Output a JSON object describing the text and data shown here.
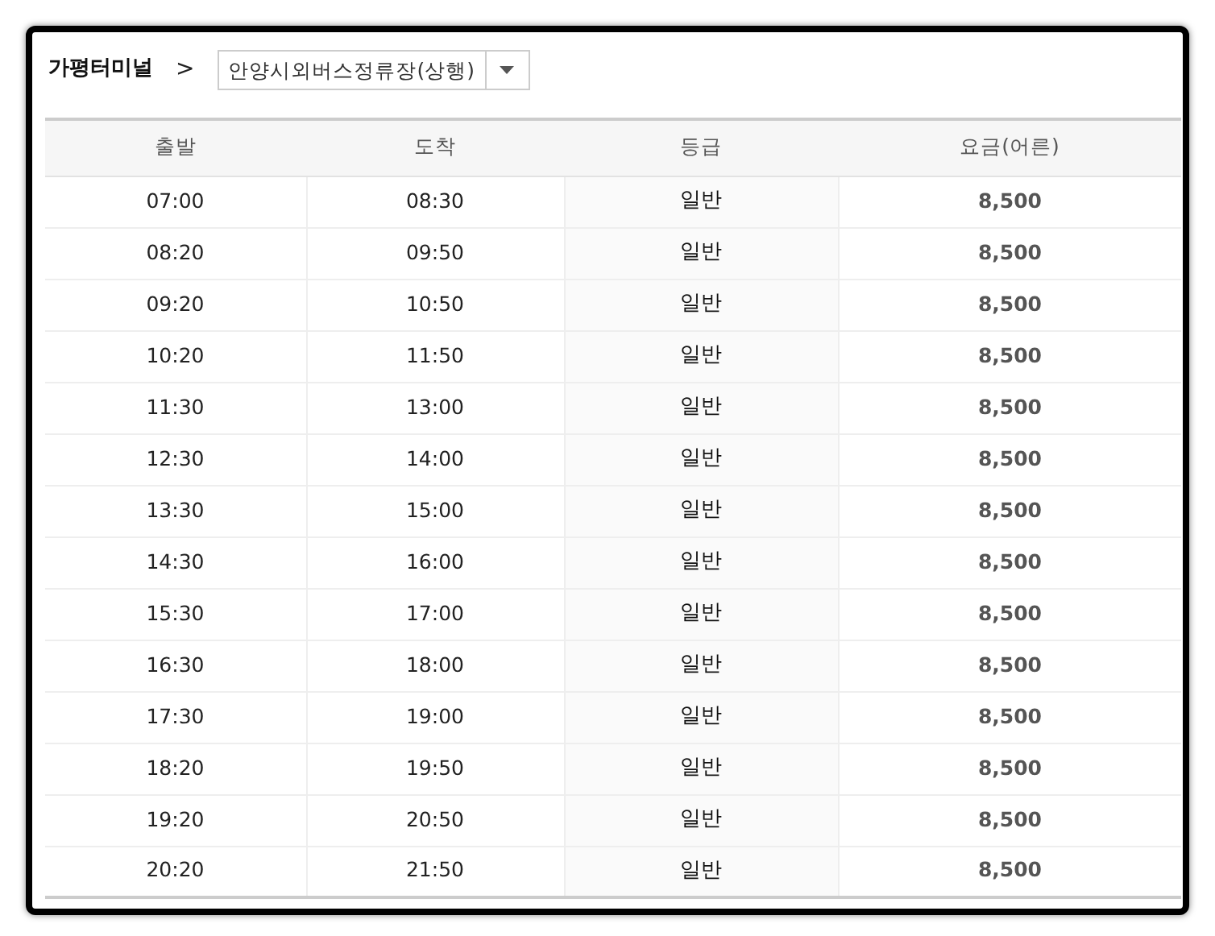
{
  "breadcrumb": {
    "terminal": "가평터미널",
    "separator": ">",
    "route_select": {
      "value": "안양시외버스정류장(상행)"
    }
  },
  "table": {
    "columns": [
      "출발",
      "도착",
      "등급",
      "요금(어른)"
    ],
    "rows": [
      [
        "07:00",
        "08:30",
        "일반",
        "8,500"
      ],
      [
        "08:20",
        "09:50",
        "일반",
        "8,500"
      ],
      [
        "09:20",
        "10:50",
        "일반",
        "8,500"
      ],
      [
        "10:20",
        "11:50",
        "일반",
        "8,500"
      ],
      [
        "11:30",
        "13:00",
        "일반",
        "8,500"
      ],
      [
        "12:30",
        "14:00",
        "일반",
        "8,500"
      ],
      [
        "13:30",
        "15:00",
        "일반",
        "8,500"
      ],
      [
        "14:30",
        "16:00",
        "일반",
        "8,500"
      ],
      [
        "15:30",
        "17:00",
        "일반",
        "8,500"
      ],
      [
        "16:30",
        "18:00",
        "일반",
        "8,500"
      ],
      [
        "17:30",
        "19:00",
        "일반",
        "8,500"
      ],
      [
        "18:20",
        "19:50",
        "일반",
        "8,500"
      ],
      [
        "19:20",
        "20:50",
        "일반",
        "8,500"
      ],
      [
        "20:20",
        "21:50",
        "일반",
        "8,500"
      ]
    ]
  }
}
